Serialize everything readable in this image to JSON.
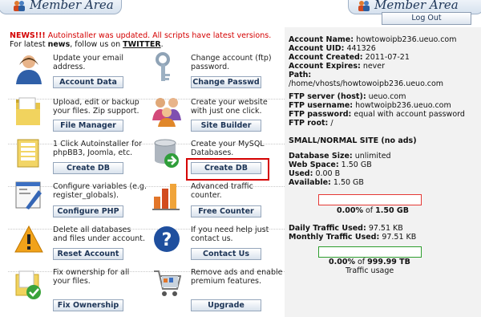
{
  "header": {
    "left_title": "Member Area",
    "right_title": "Member Area",
    "logout_label": "Log Out"
  },
  "news": {
    "prefix": "NEWS!!!",
    "message": " Autoinstaller was updated. All scripts have latest versions.",
    "line2_a": "For latest ",
    "line2_news": "news",
    "line2_b": ", follow us on ",
    "line2_link": "TWITTER",
    "line2_end": "."
  },
  "tools": [
    {
      "text": "Update your email address.",
      "button": "Account Data"
    },
    {
      "text": "Change account (ftp) password.",
      "button": "Change Passwd"
    },
    {
      "text": "Upload, edit or backup your files. Zip support.",
      "button": "File Manager"
    },
    {
      "text": "Create your website with just one click.",
      "button": "Site Builder"
    },
    {
      "text": "1 Click Autoinstaller for phpBB3, Joomla, etc.",
      "button": "Create DB"
    },
    {
      "text": "Create your MySQL Databases.",
      "button": "Create DB"
    },
    {
      "text": "Configure variables (e.g. register_globals).",
      "button": "Configure PHP"
    },
    {
      "text": "Advanced traffic counter.",
      "button": "Free Counter"
    },
    {
      "text": "Delete all databases and files under account.",
      "button": "Reset Account"
    },
    {
      "text": "If you need help just contact us.",
      "button": "Contact Us"
    },
    {
      "text": "Fix ownership for all your files.",
      "button": "Fix Ownership"
    },
    {
      "text": "Remove ads and enable premium features.",
      "button": "Upgrade"
    }
  ],
  "account": {
    "name_label": "Account Name:",
    "name_value": "howtowoipb236.ueuo.com",
    "uid_label": "Account UID:",
    "uid_value": "441326",
    "created_label": "Account Created:",
    "created_value": "2011-07-21",
    "expires_label": "Account Expires:",
    "expires_value": "never",
    "path_label": "Path:",
    "path_value": "/home/vhosts/howtowoipb236.ueuo.com",
    "ftp_server_label": "FTP server (host):",
    "ftp_server_value": "ueuo.com",
    "ftp_user_label": "FTP username:",
    "ftp_user_value": "howtwoipb236.ueuo.com",
    "ftp_pass_label": "FTP password:",
    "ftp_pass_value": "equal with account password",
    "ftp_root_label": "FTP root:",
    "ftp_root_value": "/"
  },
  "site": {
    "heading": "SMALL/NORMAL SITE (no ads)",
    "db_size_label": "Database Size:",
    "db_size_value": "unlimited",
    "web_space_label": "Web Space:",
    "web_space_value": "1.50 GB",
    "used_label": "Used:",
    "used_value": "0.00 B",
    "available_label": "Available:",
    "available_value": "1.50 GB",
    "space_pct": "0.00%",
    "space_of": " of ",
    "space_total": "1.50 GB",
    "daily_label": "Daily Traffic Used:",
    "daily_value": "97.51 KB",
    "monthly_label": "Monthly Traffic Used:",
    "monthly_value": "97.51 KB",
    "traffic_pct": "0.00%",
    "traffic_of": " of ",
    "traffic_total": "999.99 TB",
    "traffic_caption": "Traffic usage"
  },
  "colors": {
    "space_bar_border": "#e53935",
    "traffic_bar_border": "#2e9e2e",
    "highlight": "#d50000"
  },
  "icons": [
    "user-icon",
    "key-icon",
    "folder-icon",
    "people-icon",
    "database-stack-icon",
    "database-add-icon",
    "settings-window-icon",
    "bar-chart-icon",
    "warning-icon",
    "help-icon",
    "folder-check-icon",
    "cart-icon"
  ]
}
